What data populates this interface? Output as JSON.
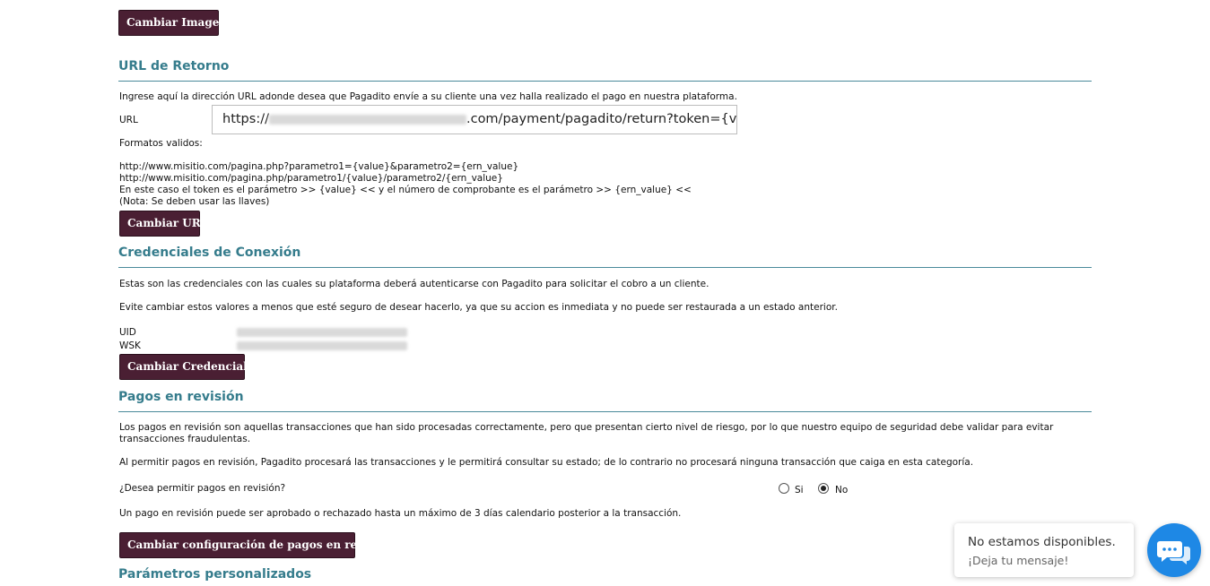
{
  "image_section": {
    "change_image_button": "Cambiar Imagen"
  },
  "return_url": {
    "heading": "URL de Retorno",
    "description": "Ingrese aquí la dirección URL adonde desea que Pagadito envíe a su cliente una vez halla realizado el pago en nuestra plataforma.",
    "url_label": "URL",
    "url_prefix": "https://",
    "url_suffix": ".com/payment/pagadito/return?token={value}&e",
    "formats_label": "Formatos validos:",
    "format_1": "http://www.misitio.com/pagina.php?parametro1={value}&parametro2={ern_value}",
    "format_2": "http://www.misitio.com/pagina.php/parametro1/{value}/parametro2/{ern_value}",
    "explanation": "En este caso el token es el parámetro >> {value} << y el número de comprobante es el parámetro >> {ern_value} <<",
    "note": "(Nota: Se deben usar las llaves)",
    "change_url_button": "Cambiar URL"
  },
  "credentials": {
    "heading": "Credenciales de Conexión",
    "description": "Estas son las credenciales con las cuales su plataforma deberá autenticarse con Pagadito para solicitar el cobro a un cliente.",
    "warning": "Evite cambiar estos valores a menos que esté seguro de desear hacerlo, ya que su accion es inmediata y no puede ser restaurada a un estado anterior.",
    "uid_label": "UID",
    "wsk_label": "WSK",
    "change_credentials_button": "Cambiar Credenciales"
  },
  "review_payments": {
    "heading": "Pagos en revisión",
    "description": "Los pagos en revisión son aquellas transacciones que han sido procesadas correctamente, pero que presentan cierto nivel de riesgo, por lo que nuestro equipo de seguridad debe validar para evitar transacciones fraudulentas.",
    "info": "Al permitir pagos en revisión, Pagadito procesará las transacciones y le permitirá consultar su estado; de lo contrario no procesará ninguna transacción que caiga en esta categoría.",
    "question": "¿Desea permitir pagos en revisión?",
    "option_yes": "Si",
    "option_no": "No",
    "selected": "No",
    "limit_note": "Un pago en revisión puede ser aprobado o rechazado hasta un máximo de 3 días calendario posterior a la transacción.",
    "change_config_button": "Cambiar configuración de pagos en revisión"
  },
  "custom_params": {
    "heading": "Parámetros personalizados"
  },
  "chat": {
    "status": "No estamos disponibles.",
    "prompt": "¡Deja tu mensaje!",
    "icon": "chat-bubbles-icon",
    "accent": "#1e88e5"
  }
}
